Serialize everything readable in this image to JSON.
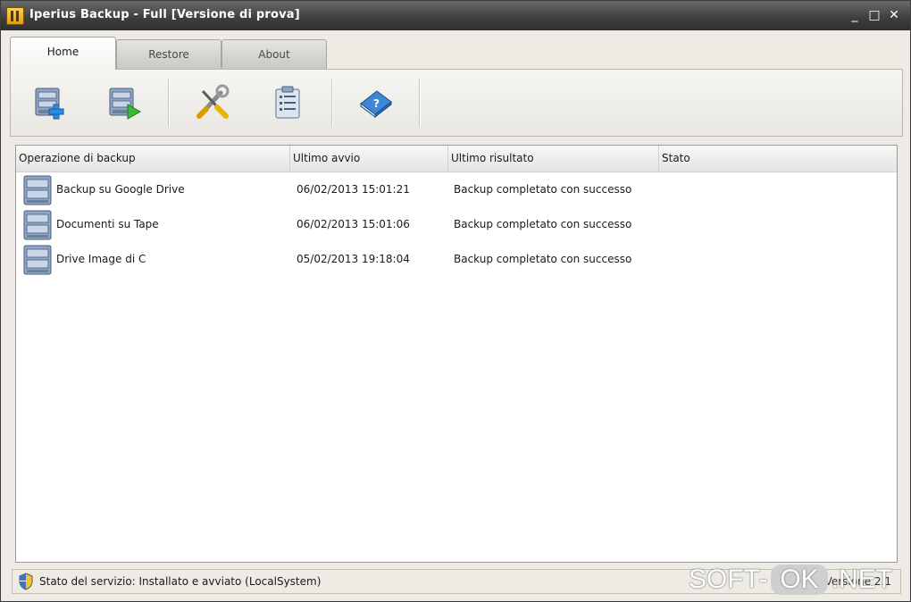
{
  "window": {
    "title": "Iperius Backup - Full  [Versione di prova]",
    "controls": [
      "_",
      "□",
      "✕"
    ]
  },
  "tabs": [
    {
      "label": "Home",
      "active": true
    },
    {
      "label": "Restore",
      "active": false
    },
    {
      "label": "About",
      "active": false
    }
  ],
  "toolbar": {
    "buttons": [
      {
        "icon": "new-backup-icon"
      },
      {
        "icon": "run-backup-icon"
      },
      {
        "icon": "tools-icon"
      },
      {
        "icon": "log-clipboard-icon"
      },
      {
        "icon": "help-book-icon"
      }
    ]
  },
  "table": {
    "columns": [
      "Operazione di backup",
      "Ultimo avvio",
      "Ultimo risultato",
      "Stato"
    ],
    "rows": [
      {
        "name": "Backup su Google Drive",
        "last_run": "06/02/2013 15:01:21",
        "result": "Backup completato con successo",
        "state": ""
      },
      {
        "name": "Documenti su Tape",
        "last_run": "06/02/2013 15:01:06",
        "result": "Backup completato con successo",
        "state": ""
      },
      {
        "name": "Drive Image di C",
        "last_run": "05/02/2013 19:18:04",
        "result": "Backup completato con successo",
        "state": ""
      }
    ]
  },
  "status": {
    "service": "Stato del servizio: Installato e avviato (LocalSystem)",
    "version": "Versione 2.1"
  },
  "watermark": {
    "left": "SOFT-",
    "middle": "OK",
    "right": ".NET"
  }
}
